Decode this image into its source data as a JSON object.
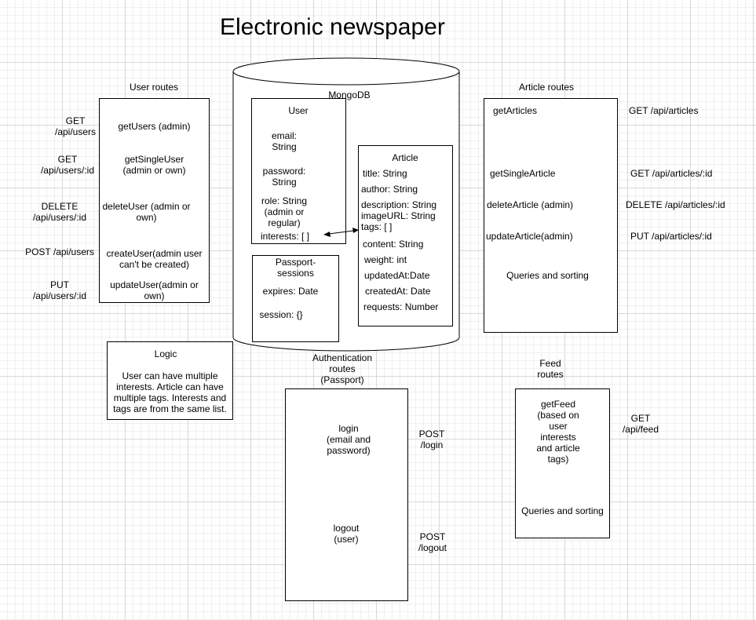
{
  "title": "Electronic newspaper",
  "database": {
    "label": "MongoDB"
  },
  "user_routes": {
    "heading": "User routes",
    "items": [
      {
        "method": "GET\n/api/users",
        "handler": "getUsers (admin)"
      },
      {
        "method": "GET\n/api/users/:id",
        "handler": "getSingleUser\n(admin or own)"
      },
      {
        "method": "DELETE\n/api/users/:id",
        "handler": "deleteUser (admin or\nown)"
      },
      {
        "method": "POST /api/users",
        "handler": "createUser(admin user\ncan't be created)"
      },
      {
        "method": "PUT\n/api/users/:id",
        "handler": "updateUser(admin or\nown)"
      }
    ]
  },
  "user_model": {
    "heading": "User",
    "fields": [
      "email:\nString",
      "password:\nString",
      "role: String\n(admin or\nregular)",
      "interests: [ ]"
    ]
  },
  "passport_sessions": {
    "heading": "Passport-\nsessions",
    "fields": [
      "expires: Date",
      "session: {}"
    ]
  },
  "article_model": {
    "heading": "Article",
    "fields": [
      "title: String",
      "author: String",
      "description: String\nimageURL: String\ntags: [ ]",
      "content: String",
      "weight: int",
      "updatedAt:Date",
      "createdAt: Date",
      "requests: Number"
    ]
  },
  "article_routes": {
    "heading": "Article routes",
    "items": [
      {
        "handler": "getArticles",
        "method": "GET /api/articles"
      },
      {
        "handler": "getSingleArticle",
        "method": "GET /api/articles/:id"
      },
      {
        "handler": "deleteArticle (admin)",
        "method": "DELETE /api/articles/:id"
      },
      {
        "handler": "updateArticle(admin)",
        "method": "PUT /api/articles/:id"
      }
    ],
    "footer": "Queries and sorting"
  },
  "logic": {
    "heading": "Logic",
    "text": "User can have multiple\ninterests. Article can have\nmultiple tags. Interests and\ntags are from the same list."
  },
  "auth_routes": {
    "heading": "Authentication\nroutes\n(Passport)",
    "items": [
      {
        "handler": "login\n(email and\npassword)",
        "method": "POST\n/login"
      },
      {
        "handler": "logout\n(user)",
        "method": "POST\n/logout"
      }
    ]
  },
  "feed_routes": {
    "heading": "Feed\nroutes",
    "handler": "getFeed\n(based on\nuser\ninterests\nand article\ntags)",
    "footer": "Queries and sorting",
    "method": "GET\n/api/feed"
  }
}
